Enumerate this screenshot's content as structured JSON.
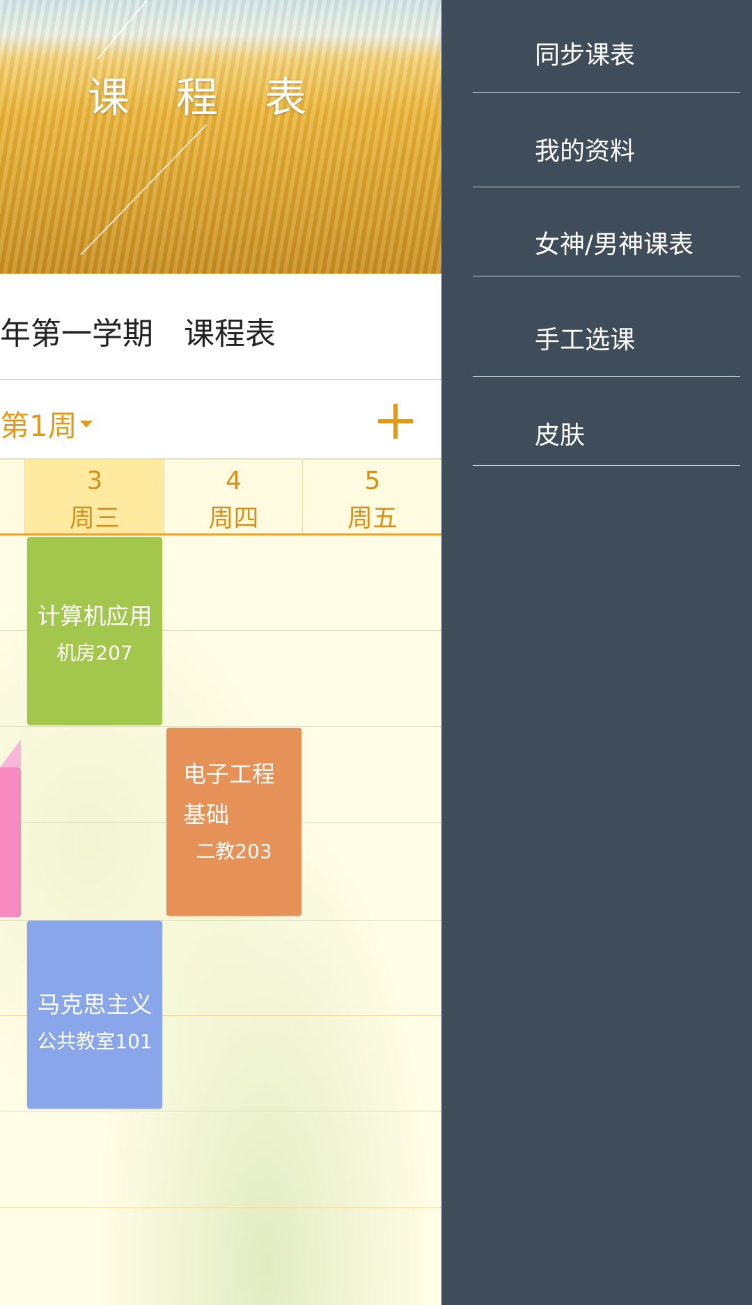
{
  "banner": {
    "title": "课 程 表"
  },
  "term": {
    "text": "年第一学期　课程表"
  },
  "week": {
    "label": "第1周"
  },
  "days": [
    {
      "num": "3",
      "name": "周三"
    },
    {
      "num": "4",
      "name": "周四"
    },
    {
      "num": "5",
      "name": "周五"
    }
  ],
  "courses": [
    {
      "name": "计算机应用",
      "room": "机房207",
      "color": "#a3c64d"
    },
    {
      "name1": "电子工程",
      "name2": "基础",
      "room": "二教203",
      "color": "#e69157"
    },
    {
      "name": "马克思主义",
      "room": "公共教室101",
      "color": "#88a6e9"
    }
  ],
  "drawer": {
    "items": [
      "同步课表",
      "我的资料",
      "女神/男神课表",
      "手工选课",
      "皮肤"
    ]
  },
  "colors": {
    "accent": "#e09a17",
    "drawer_bg": "#3f4c59",
    "pink_course": "#f98ac0"
  }
}
